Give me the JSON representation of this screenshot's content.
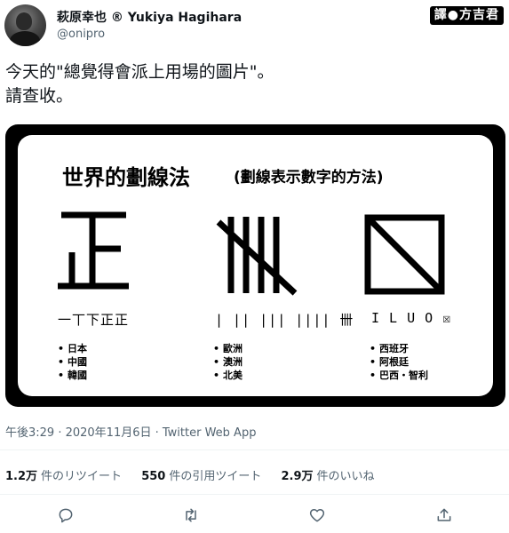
{
  "user": {
    "name": "萩原幸也 ® Yukiya Hagihara",
    "handle": "@onipro"
  },
  "badge": "譯●方吉君",
  "tweet": {
    "line1": "今天的\"總覺得會派上用場的圖片\"。",
    "line2": "請查收。"
  },
  "image": {
    "title": "世界的劃線法",
    "subtitle": "(劃線表示數字的方法)",
    "systems": [
      {
        "sequence": "一丅下正正",
        "regions": [
          "日本",
          "中國",
          "韓國"
        ]
      },
      {
        "sequence": "| || ||| |||| 卌",
        "regions": [
          "歐洲",
          "澳洲",
          "北美"
        ]
      },
      {
        "sequence": "I L U O ☒",
        "regions": [
          "西班牙",
          "阿根廷",
          "巴西・智利"
        ]
      }
    ]
  },
  "meta": "午後3:29 · 2020年11月6日 · Twitter Web App",
  "stats": [
    {
      "value": "1.2万",
      "label": "件のリツイート"
    },
    {
      "value": "550",
      "label": "件の引用ツイート"
    },
    {
      "value": "2.9万",
      "label": "件のいいね"
    }
  ],
  "colors": {
    "text": "#0f1419",
    "muted": "#536471",
    "divider": "#eff3f4"
  }
}
